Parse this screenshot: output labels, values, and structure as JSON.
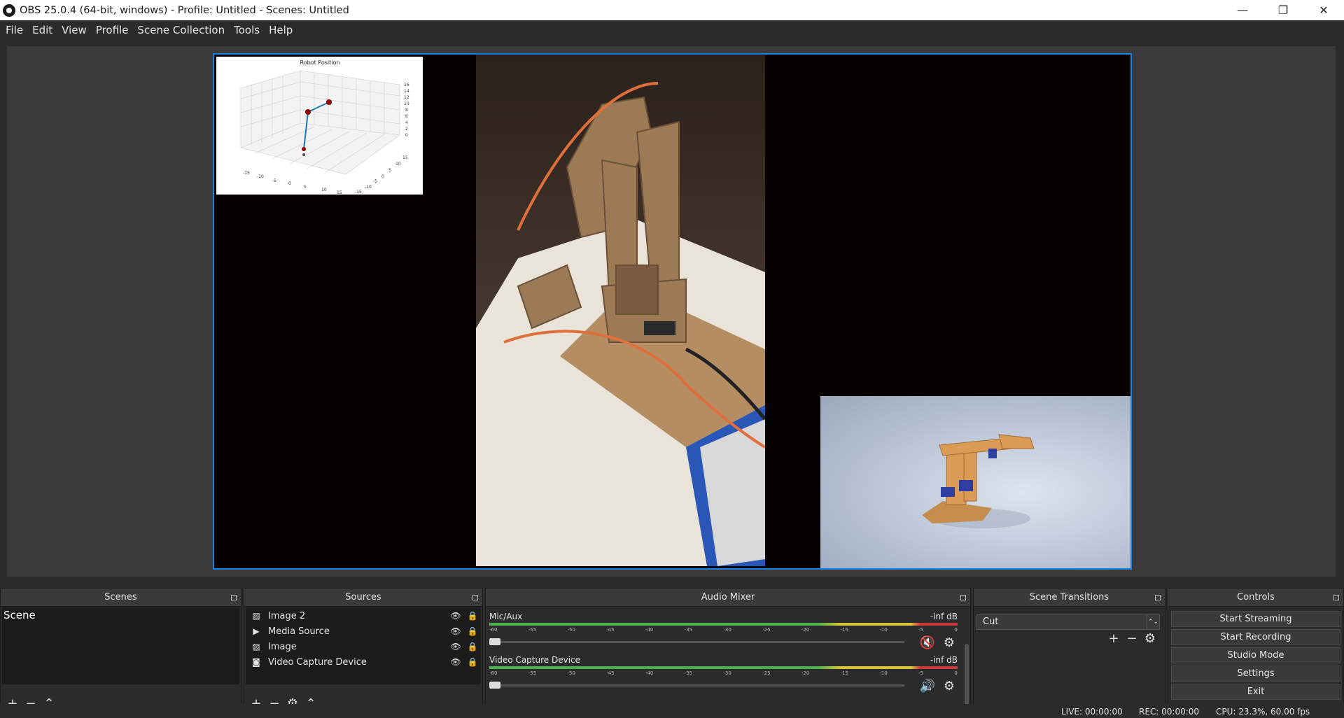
{
  "window": {
    "title": "OBS 25.0.4 (64-bit, windows) - Profile: Untitled - Scenes: Untitled"
  },
  "menu": [
    "File",
    "Edit",
    "View",
    "Profile",
    "Scene Collection",
    "Tools",
    "Help"
  ],
  "preview": {
    "plot_title": "Robot Position",
    "plot_ticks_x": [
      "-15",
      "-10",
      "-5",
      "0",
      "5",
      "10",
      "15"
    ],
    "plot_ticks_y": [
      "15",
      "10",
      "5",
      "0",
      "-5",
      "-10",
      "-15"
    ],
    "plot_ticks_z": [
      "16",
      "14",
      "12",
      "10",
      "8",
      "6",
      "4",
      "2",
      "0"
    ]
  },
  "docks": {
    "scenes": {
      "title": "Scenes",
      "items": [
        "Scene"
      ]
    },
    "sources": {
      "title": "Sources",
      "items": [
        {
          "icon": "image-icon",
          "name": "Image 2"
        },
        {
          "icon": "play-icon",
          "name": "Media Source"
        },
        {
          "icon": "image-icon",
          "name": "Image"
        },
        {
          "icon": "camera-icon",
          "name": "Video Capture Device"
        }
      ]
    },
    "mixer": {
      "title": "Audio Mixer",
      "tracks": [
        {
          "name": "Mic/Aux",
          "db": "-inf dB",
          "muted": true
        },
        {
          "name": "Video Capture Device",
          "db": "-inf dB",
          "muted": false
        }
      ],
      "scale": [
        "-60",
        "-55",
        "-50",
        "-45",
        "-40",
        "-35",
        "-30",
        "-25",
        "-20",
        "-15",
        "-10",
        "-5",
        "0"
      ]
    },
    "transitions": {
      "title": "Scene Transitions",
      "selected": "Cut"
    },
    "controls": {
      "title": "Controls",
      "buttons": [
        "Start Streaming",
        "Start Recording",
        "Studio Mode",
        "Settings",
        "Exit"
      ]
    }
  },
  "status": {
    "live": "LIVE: 00:00:00",
    "rec": "REC: 00:00:00",
    "cpu": "CPU: 23.3%, 60.00 fps"
  },
  "colors": {
    "accent": "#1f7fe0",
    "mute": "#e02020"
  }
}
